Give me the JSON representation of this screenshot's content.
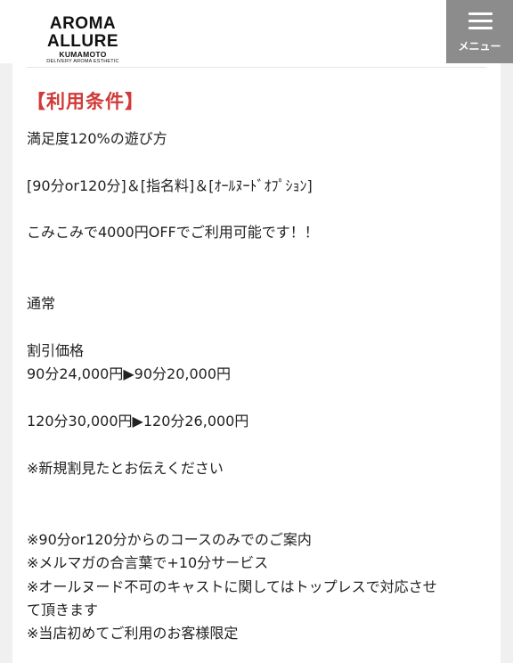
{
  "header": {
    "logo": {
      "main": "AROMA ALLURE",
      "sub": "KUMAMOTO",
      "tagline": "DELIVERY AROMA ESTHETIC"
    },
    "menu_label": "メニュー"
  },
  "content": {
    "title": "【利用条件】",
    "lines": [
      "満足度120%の遊び方",
      "[90分or120分]＆[指名料]＆[ｵｰﾙﾇｰﾄﾞｵﾌﾟｼｮﾝ]",
      "こみこみで4000円OFFでご利用可能です！！",
      "通常",
      "割引価格",
      "90分24,000円▶90分20,000円",
      "120分30,000円▶120分26,000円",
      "※新規割見たとお伝えください",
      "※90分or120分からのコースのみでのご案内",
      "※メルマガの合言葉で+10分サービス",
      "※オールヌード不可のキャストに関してはトップレスで対応させ",
      "て頂きます",
      "※当店初めてご利用のお客様限定"
    ]
  },
  "colors": {
    "title": "#d03a3a",
    "menu_bg": "#8c8c8c",
    "page_bg": "#f0f0f0"
  }
}
